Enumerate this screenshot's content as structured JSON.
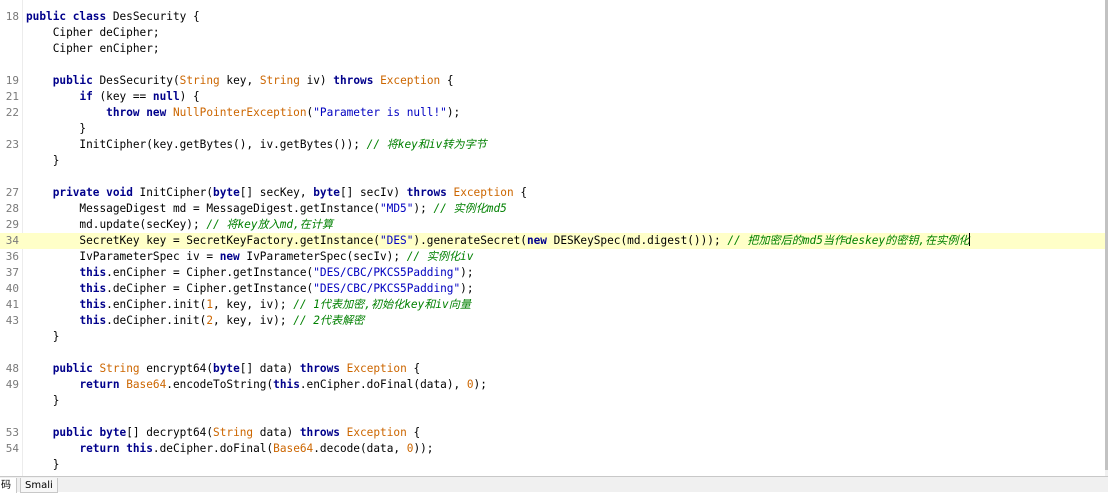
{
  "editor": {
    "current_line_index": 14,
    "lines": [
      {
        "ln": "18",
        "tokens": [
          [
            "kw",
            "public class "
          ],
          [
            "plain",
            "DesSecurity {"
          ]
        ]
      },
      {
        "ln": "",
        "tokens": [
          [
            "plain",
            "    Cipher deCipher;"
          ]
        ]
      },
      {
        "ln": "",
        "tokens": [
          [
            "plain",
            "    Cipher enCipher;"
          ]
        ]
      },
      {
        "ln": "",
        "tokens": []
      },
      {
        "ln": "19",
        "tokens": [
          [
            "plain",
            "    "
          ],
          [
            "kw",
            "public "
          ],
          [
            "plain",
            "DesSecurity("
          ],
          [
            "type",
            "String "
          ],
          [
            "plain",
            "key, "
          ],
          [
            "type",
            "String "
          ],
          [
            "plain",
            "iv) "
          ],
          [
            "kw",
            "throws "
          ],
          [
            "type",
            "Exception "
          ],
          [
            "plain",
            "{"
          ]
        ]
      },
      {
        "ln": "21",
        "tokens": [
          [
            "plain",
            "        "
          ],
          [
            "kw",
            "if "
          ],
          [
            "plain",
            "(key == "
          ],
          [
            "kw",
            "null"
          ],
          [
            "plain",
            ") {"
          ]
        ]
      },
      {
        "ln": "22",
        "tokens": [
          [
            "plain",
            "            "
          ],
          [
            "kw",
            "throw new "
          ],
          [
            "type",
            "NullPointerException"
          ],
          [
            "plain",
            "("
          ],
          [
            "str",
            "\"Parameter is null!\""
          ],
          [
            "plain",
            ");"
          ]
        ]
      },
      {
        "ln": "",
        "tokens": [
          [
            "plain",
            "        }"
          ]
        ]
      },
      {
        "ln": "23",
        "tokens": [
          [
            "plain",
            "        InitCipher(key.getBytes(), iv.getBytes()); "
          ],
          [
            "com",
            "// 将key和iv转为字节"
          ]
        ]
      },
      {
        "ln": "",
        "tokens": [
          [
            "plain",
            "    }"
          ]
        ]
      },
      {
        "ln": "",
        "tokens": []
      },
      {
        "ln": "27",
        "tokens": [
          [
            "plain",
            "    "
          ],
          [
            "kw",
            "private void "
          ],
          [
            "plain",
            "InitCipher("
          ],
          [
            "kw",
            "byte"
          ],
          [
            "plain",
            "[] secKey, "
          ],
          [
            "kw",
            "byte"
          ],
          [
            "plain",
            "[] secIv) "
          ],
          [
            "kw",
            "throws "
          ],
          [
            "type",
            "Exception "
          ],
          [
            "plain",
            "{"
          ]
        ]
      },
      {
        "ln": "28",
        "tokens": [
          [
            "plain",
            "        MessageDigest md = MessageDigest.getInstance("
          ],
          [
            "str",
            "\"MD5\""
          ],
          [
            "plain",
            "); "
          ],
          [
            "com",
            "// 实例化md5"
          ]
        ]
      },
      {
        "ln": "29",
        "tokens": [
          [
            "plain",
            "        md.update(secKey); "
          ],
          [
            "com",
            "// 将key放入md,在计算"
          ]
        ]
      },
      {
        "ln": "34",
        "tokens": [
          [
            "plain",
            "        SecretKey key = SecretKeyFactory.getInstance("
          ],
          [
            "str",
            "\"DES\""
          ],
          [
            "plain",
            ").generateSecret("
          ],
          [
            "kw",
            "new "
          ],
          [
            "plain",
            "DESKeySpec(md.digest())); "
          ],
          [
            "com",
            "// 把加密后的md5当作deskey的密钥,在实例化"
          ]
        ]
      },
      {
        "ln": "36",
        "tokens": [
          [
            "plain",
            "        IvParameterSpec iv = "
          ],
          [
            "kw",
            "new "
          ],
          [
            "plain",
            "IvParameterSpec(secIv); "
          ],
          [
            "com",
            "// 实例化iv"
          ]
        ]
      },
      {
        "ln": "37",
        "tokens": [
          [
            "plain",
            "        "
          ],
          [
            "kw",
            "this"
          ],
          [
            "plain",
            ".enCipher = Cipher.getInstance("
          ],
          [
            "str",
            "\"DES/CBC/PKCS5Padding\""
          ],
          [
            "plain",
            ");"
          ]
        ]
      },
      {
        "ln": "40",
        "tokens": [
          [
            "plain",
            "        "
          ],
          [
            "kw",
            "this"
          ],
          [
            "plain",
            ".deCipher = Cipher.getInstance("
          ],
          [
            "str",
            "\"DES/CBC/PKCS5Padding\""
          ],
          [
            "plain",
            ");"
          ]
        ]
      },
      {
        "ln": "41",
        "tokens": [
          [
            "plain",
            "        "
          ],
          [
            "kw",
            "this"
          ],
          [
            "plain",
            ".enCipher.init("
          ],
          [
            "num",
            "1"
          ],
          [
            "plain",
            ", key, iv); "
          ],
          [
            "com",
            "// 1代表加密,初始化key和iv向量"
          ]
        ]
      },
      {
        "ln": "43",
        "tokens": [
          [
            "plain",
            "        "
          ],
          [
            "kw",
            "this"
          ],
          [
            "plain",
            ".deCipher.init("
          ],
          [
            "num",
            "2"
          ],
          [
            "plain",
            ", key, iv); "
          ],
          [
            "com",
            "// 2代表解密"
          ]
        ]
      },
      {
        "ln": "",
        "tokens": [
          [
            "plain",
            "    }"
          ]
        ]
      },
      {
        "ln": "",
        "tokens": []
      },
      {
        "ln": "48",
        "tokens": [
          [
            "plain",
            "    "
          ],
          [
            "kw",
            "public "
          ],
          [
            "type",
            "String "
          ],
          [
            "plain",
            "encrypt64("
          ],
          [
            "kw",
            "byte"
          ],
          [
            "plain",
            "[] data) "
          ],
          [
            "kw",
            "throws "
          ],
          [
            "type",
            "Exception "
          ],
          [
            "plain",
            "{"
          ]
        ]
      },
      {
        "ln": "49",
        "tokens": [
          [
            "plain",
            "        "
          ],
          [
            "kw",
            "return "
          ],
          [
            "type",
            "Base64"
          ],
          [
            "plain",
            ".encodeToString("
          ],
          [
            "kw",
            "this"
          ],
          [
            "plain",
            ".enCipher.doFinal(data), "
          ],
          [
            "num",
            "0"
          ],
          [
            "plain",
            ");"
          ]
        ]
      },
      {
        "ln": "",
        "tokens": [
          [
            "plain",
            "    }"
          ]
        ]
      },
      {
        "ln": "",
        "tokens": []
      },
      {
        "ln": "53",
        "tokens": [
          [
            "plain",
            "    "
          ],
          [
            "kw",
            "public "
          ],
          [
            "kw",
            "byte"
          ],
          [
            "plain",
            "[] decrypt64("
          ],
          [
            "type",
            "String "
          ],
          [
            "plain",
            "data) "
          ],
          [
            "kw",
            "throws "
          ],
          [
            "type",
            "Exception "
          ],
          [
            "plain",
            "{"
          ]
        ]
      },
      {
        "ln": "54",
        "tokens": [
          [
            "plain",
            "        "
          ],
          [
            "kw",
            "return this"
          ],
          [
            "plain",
            ".deCipher.doFinal("
          ],
          [
            "type",
            "Base64"
          ],
          [
            "plain",
            ".decode(data, "
          ],
          [
            "num",
            "0"
          ],
          [
            "plain",
            "));"
          ]
        ]
      },
      {
        "ln": "",
        "tokens": [
          [
            "plain",
            "    }"
          ]
        ]
      }
    ]
  },
  "bottom_tabs": {
    "code_label": "码",
    "smali_label": "Smali"
  },
  "colors": {
    "keyword": "#00008b",
    "type": "#cc6600",
    "string": "#0000c0",
    "comment": "#008000",
    "line_number": "#7a7a7a",
    "current_line": "#ffffc8"
  }
}
